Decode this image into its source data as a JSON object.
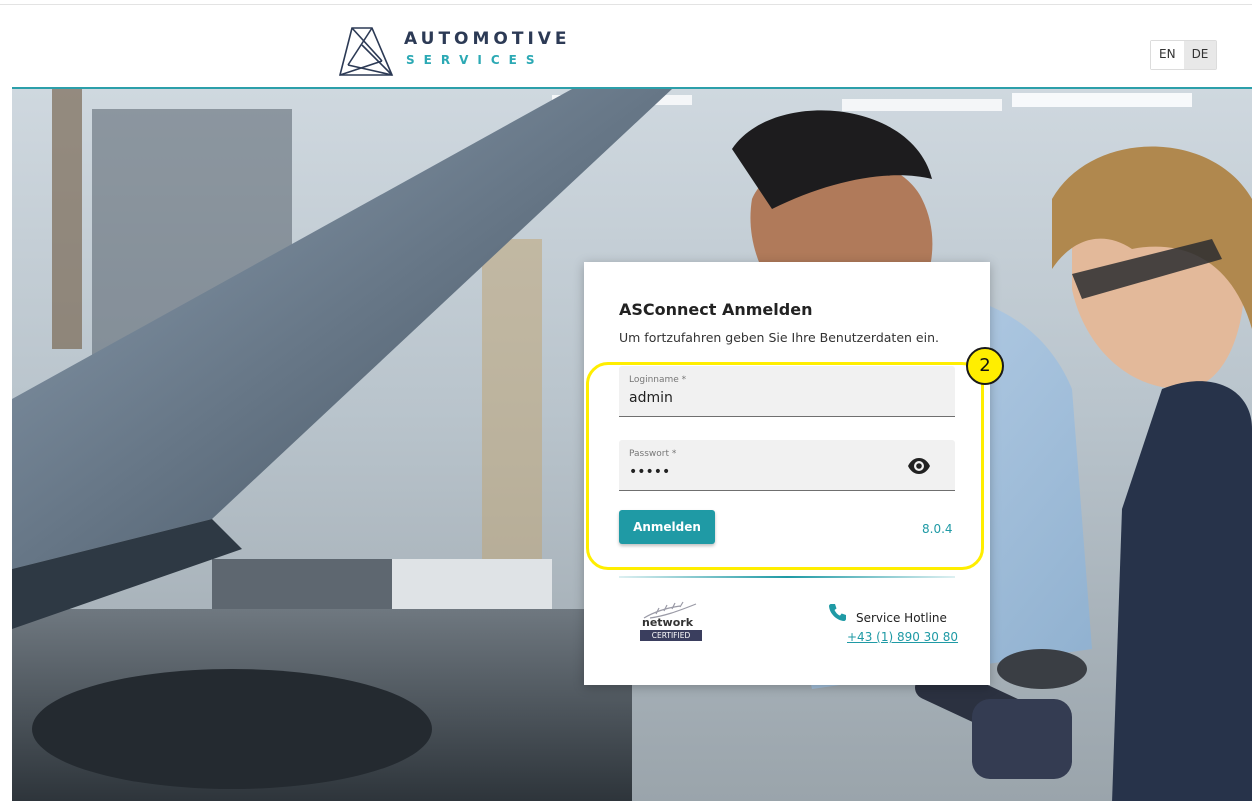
{
  "header": {
    "logo_line1": "AUTOMOTIVE",
    "logo_line2": "SERVICES",
    "languages": [
      {
        "code": "EN",
        "active": false
      },
      {
        "code": "DE",
        "active": true
      }
    ]
  },
  "login": {
    "title": "ASConnect Anmelden",
    "subtitle": "Um fortzufahren geben Sie Ihre Benutzerdaten ein.",
    "username_label": "Loginname *",
    "username_value": "admin",
    "password_label": "Passwort *",
    "password_value": "•••••",
    "submit_label": "Anmelden",
    "version": "8.0.4"
  },
  "footer": {
    "cert_word": "network",
    "cert_badge": "CERTIFIED",
    "hotline_label": "Service Hotline",
    "hotline_number": "+43 (1) 890 30 80"
  },
  "annotation": {
    "step_number": "2"
  },
  "colors": {
    "accent": "#1f9aa5",
    "brand_dark": "#2c3a55",
    "highlight": "#ffee00"
  },
  "icons": [
    "automotive-services-logo",
    "eye-icon",
    "phone-icon",
    "network-certified-logo"
  ]
}
